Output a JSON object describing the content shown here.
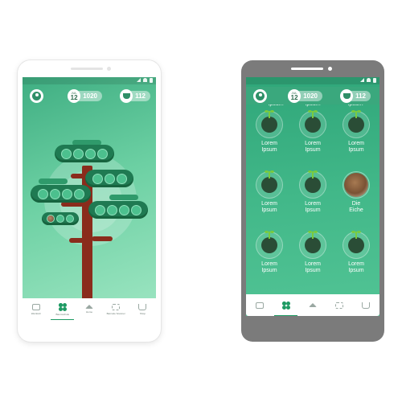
{
  "left_phone": {
    "date_badge": {
      "month": "JUL",
      "day": "12"
    },
    "points": "1020",
    "trophies": "112",
    "nav": [
      {
        "label": "Weinfeld",
        "icon": "wallet-icon"
      },
      {
        "label": "Baumschule",
        "icon": "clover-icon"
      },
      {
        "label": "Home",
        "icon": "home-icon"
      },
      {
        "label": "Barcode Scanner",
        "icon": "barcode-icon"
      },
      {
        "label": "Shop",
        "icon": "cart-icon"
      }
    ]
  },
  "right_phone": {
    "date_badge": {
      "month": "JUL",
      "day": "12"
    },
    "points": "1020",
    "trophies": "112",
    "cut_top_labels": [
      "Ipsum",
      "Ipsum",
      "Ipsum"
    ],
    "grid": [
      {
        "line1": "Lorem",
        "line2": "Ipsum",
        "kind": "sprout"
      },
      {
        "line1": "Lorem",
        "line2": "Ipsum",
        "kind": "sprout"
      },
      {
        "line1": "Lorem",
        "line2": "Ipsum",
        "kind": "sprout"
      },
      {
        "line1": "Lorem",
        "line2": "Ipsum",
        "kind": "sprout"
      },
      {
        "line1": "Lorem",
        "line2": "Ipsum",
        "kind": "sprout"
      },
      {
        "line1": "Die",
        "line2": "Eiche",
        "kind": "photo"
      },
      {
        "line1": "Lorem",
        "line2": "Ipsum",
        "kind": "sprout"
      },
      {
        "line1": "Lorem",
        "line2": "Ipsum",
        "kind": "sprout"
      },
      {
        "line1": "Lorem",
        "line2": "Ipsum",
        "kind": "sprout"
      }
    ]
  },
  "colors": {
    "accent": "#1e9a63",
    "trunk": "#8a2c1c",
    "phone_frame_dark": "#7b7b7b"
  }
}
